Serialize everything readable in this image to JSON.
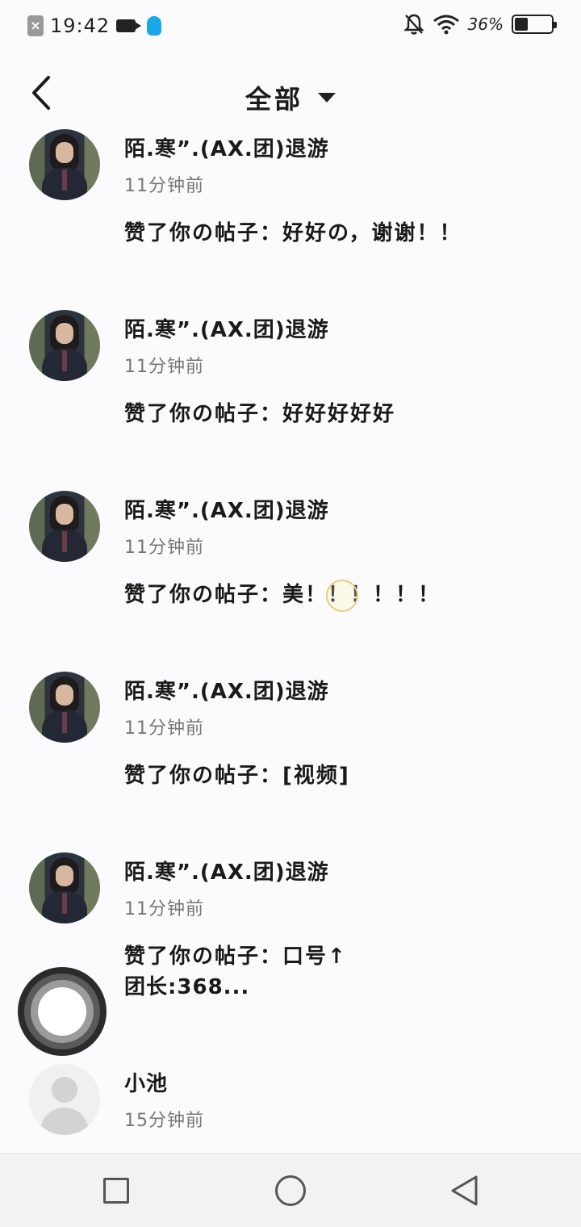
{
  "status_bar": {
    "time": "19:42",
    "battery_percent_label": "36%",
    "battery_level": 0.36,
    "icons": [
      "close-icon",
      "video-camera-icon",
      "qq-penguin-icon",
      "bell-off-icon",
      "wifi-icon",
      "battery-icon"
    ]
  },
  "header": {
    "back_icon": "back-arrow-icon",
    "title": "全部",
    "dropdown_icon": "caret-down-icon"
  },
  "notifications": [
    {
      "name": "陌.寒”.(AX.团)退游",
      "time": "11分钟前",
      "message": "赞了你の帖子：好好の，谢谢！！"
    },
    {
      "name": "陌.寒”.(AX.团)退游",
      "time": "11分钟前",
      "message": "赞了你の帖子：好好好好好"
    },
    {
      "name": "陌.寒”.(AX.团)退游",
      "time": "11分钟前",
      "message": "赞了你の帖子：美！！！！！！"
    },
    {
      "name": "陌.寒”.(AX.团)退游",
      "time": "11分钟前",
      "message": "赞了你の帖子：[视频]"
    },
    {
      "name": "陌.寒”.(AX.团)退游",
      "time": "11分钟前",
      "message": "赞了你の帖子：口号↑",
      "message_line2": "团长:368..."
    },
    {
      "name": "小池",
      "time": "15分钟前"
    }
  ],
  "nav_bar": {
    "icons": [
      "recent-apps-icon",
      "home-icon",
      "back-triangle-icon"
    ]
  }
}
